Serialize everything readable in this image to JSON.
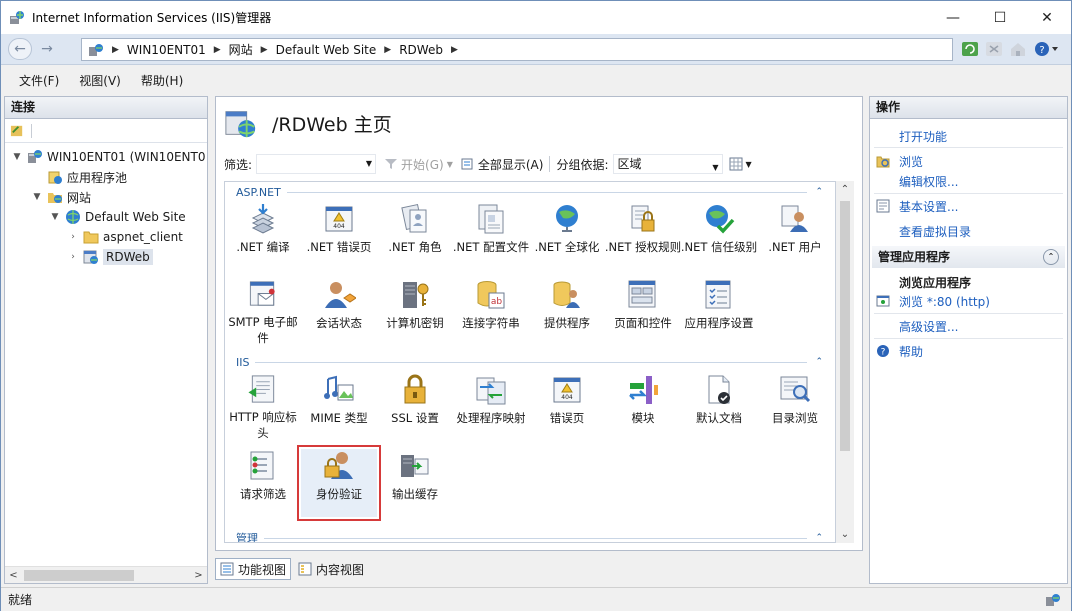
{
  "window": {
    "title": "Internet Information Services (IIS)管理器",
    "controls": {
      "minimize": "—",
      "maximize": "☐",
      "close": "✕"
    }
  },
  "address": {
    "back": "←",
    "forward": "→",
    "crumbs": [
      "WIN10ENT01",
      "网站",
      "Default Web Site",
      "RDWeb"
    ],
    "separator": "▶"
  },
  "menu": [
    "文件(F)",
    "视图(V)",
    "帮助(H)"
  ],
  "connections": {
    "title": "连接",
    "tree": [
      {
        "label": "WIN10ENT01 (WIN10ENT0",
        "toggle": "▼",
        "icon": "server-icon"
      },
      {
        "label": "应用程序池",
        "toggle": "",
        "icon": "app-pool-icon"
      },
      {
        "label": "网站",
        "toggle": "▼",
        "icon": "sites-folder-icon"
      },
      {
        "label": "Default Web Site",
        "toggle": "▼",
        "icon": "website-globe-icon"
      },
      {
        "label": "aspnet_client",
        "toggle": "›",
        "icon": "folder-icon"
      },
      {
        "label": "RDWeb",
        "toggle": "›",
        "icon": "application-icon"
      }
    ],
    "scroll_left": "<",
    "scroll_right": ">"
  },
  "main": {
    "title": "/RDWeb 主页",
    "filter_label": "筛选:",
    "start_label": "开始(G)",
    "show_all_label": "全部显示(A)",
    "group_by_label": "分组依据:",
    "group_by_value": "区域",
    "groups": [
      {
        "name": "ASP.NET",
        "features": [
          {
            "label": ".NET 编译",
            "icon": "net-compilation-icon"
          },
          {
            "label": ".NET 错误页",
            "icon": "net-error-pages-icon"
          },
          {
            "label": ".NET 角色",
            "icon": "net-roles-icon"
          },
          {
            "label": ".NET 配置文件",
            "icon": "net-profile-icon"
          },
          {
            "label": ".NET 全球化",
            "icon": "net-globalization-icon"
          },
          {
            "label": ".NET 授权规则",
            "icon": "net-authorization-icon"
          },
          {
            "label": ".NET 信任级别",
            "icon": "net-trust-levels-icon"
          },
          {
            "label": ".NET 用户",
            "icon": "net-users-icon"
          },
          {
            "label": "SMTP 电子邮件",
            "icon": "smtp-email-icon"
          },
          {
            "label": "会话状态",
            "icon": "session-state-icon"
          },
          {
            "label": "计算机密钥",
            "icon": "machine-key-icon"
          },
          {
            "label": "连接字符串",
            "icon": "connection-strings-icon"
          },
          {
            "label": "提供程序",
            "icon": "providers-icon"
          },
          {
            "label": "页面和控件",
            "icon": "pages-controls-icon"
          },
          {
            "label": "应用程序设置",
            "icon": "app-settings-icon"
          }
        ]
      },
      {
        "name": "IIS",
        "features": [
          {
            "label": "HTTP 响应标头",
            "icon": "http-headers-icon"
          },
          {
            "label": "MIME 类型",
            "icon": "mime-types-icon"
          },
          {
            "label": "SSL 设置",
            "icon": "ssl-lock-icon"
          },
          {
            "label": "处理程序映射",
            "icon": "handler-mappings-icon"
          },
          {
            "label": "错误页",
            "icon": "error-pages-icon"
          },
          {
            "label": "模块",
            "icon": "modules-icon"
          },
          {
            "label": "默认文档",
            "icon": "default-document-icon"
          },
          {
            "label": "目录浏览",
            "icon": "directory-browsing-icon"
          },
          {
            "label": "请求筛选",
            "icon": "request-filtering-icon"
          },
          {
            "label": "身份验证",
            "icon": "authentication-icon"
          },
          {
            "label": "输出缓存",
            "icon": "output-caching-icon"
          }
        ]
      },
      {
        "name": "管理",
        "features": []
      }
    ],
    "collapse_glyph": "⌃",
    "scroll_up": "⌃",
    "scroll_down": "⌄",
    "tabs": [
      "功能视图",
      "内容视图"
    ]
  },
  "actions": {
    "title": "操作",
    "links": [
      "打开功能",
      "浏览",
      "编辑权限...",
      "基本设置...",
      "查看虚拟目录"
    ],
    "manage_app_title": "管理应用程序",
    "browse_app_label": "浏览应用程序",
    "browse_port": "浏览 *:80 (http)",
    "advanced_settings": "高级设置...",
    "help": "帮助",
    "collapse_glyph": "⌃"
  },
  "status": {
    "text": "就绪"
  },
  "colors": {
    "link": "#1e5fbf",
    "group_header": "#215a9a",
    "highlight": "#d63a3a"
  }
}
